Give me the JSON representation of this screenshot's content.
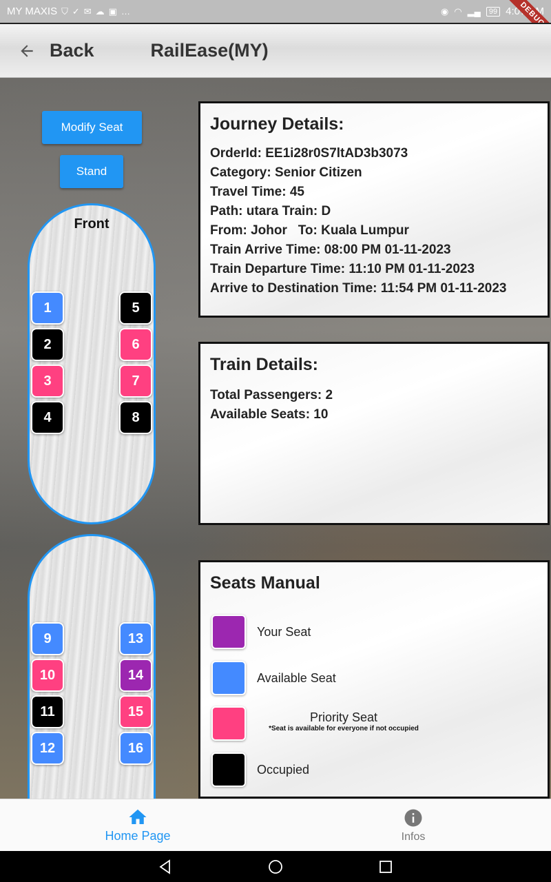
{
  "status_bar": {
    "carrier": "MY MAXIS",
    "battery": "99",
    "time": "4:07 PM",
    "debug_label": "DEBUG"
  },
  "app_bar": {
    "back_label": "Back",
    "title": "RailEase(MY)"
  },
  "actions": {
    "modify_seat": "Modify Seat",
    "stand": "Stand"
  },
  "carriage_front": {
    "label": "Front",
    "seats": [
      {
        "number": "1",
        "status": "available"
      },
      {
        "number": "2",
        "status": "occupied"
      },
      {
        "number": "3",
        "status": "priority"
      },
      {
        "number": "4",
        "status": "occupied"
      },
      {
        "number": "5",
        "status": "occupied"
      },
      {
        "number": "6",
        "status": "priority"
      },
      {
        "number": "7",
        "status": "priority"
      },
      {
        "number": "8",
        "status": "occupied"
      }
    ]
  },
  "carriage_back": {
    "seats": [
      {
        "number": "9",
        "status": "available"
      },
      {
        "number": "10",
        "status": "priority"
      },
      {
        "number": "11",
        "status": "occupied"
      },
      {
        "number": "12",
        "status": "available"
      },
      {
        "number": "13",
        "status": "available"
      },
      {
        "number": "14",
        "status": "yours"
      },
      {
        "number": "15",
        "status": "priority"
      },
      {
        "number": "16",
        "status": "available"
      }
    ]
  },
  "journey": {
    "heading": "Journey Details:",
    "order_id": "OrderId: EE1i28r0S7ltAD3b3073",
    "category": "Category: Senior Citizen",
    "travel_time": "Travel Time: 45",
    "path": "Path: utara Train: D",
    "from_to": "From: Johor   To: Kuala Lumpur",
    "arrive_time": "Train Arrive Time: 08:00 PM 01-11-2023",
    "departure_time": "Train Departure Time: 11:10 PM 01-11-2023",
    "destination_time": "Arrive to Destination Time: 11:54 PM 01-11-2023"
  },
  "train": {
    "heading": "Train Details:",
    "total_passengers": "Total Passengers: 2",
    "available_seats": "Available Seats: 10"
  },
  "manual": {
    "heading": "Seats Manual",
    "your_seat": "Your Seat",
    "available_seat": "Available Seat",
    "priority_seat": "Priority Seat",
    "priority_note": "*Seat is available for everyone if not occupied",
    "occupied": "Occupied"
  },
  "colors": {
    "yours": "#9c27b0",
    "available": "#448aff",
    "priority": "#ff4081",
    "occupied": "#000000",
    "accent": "#2196f3"
  },
  "bottom_nav": {
    "home": "Home Page",
    "infos": "Infos"
  }
}
